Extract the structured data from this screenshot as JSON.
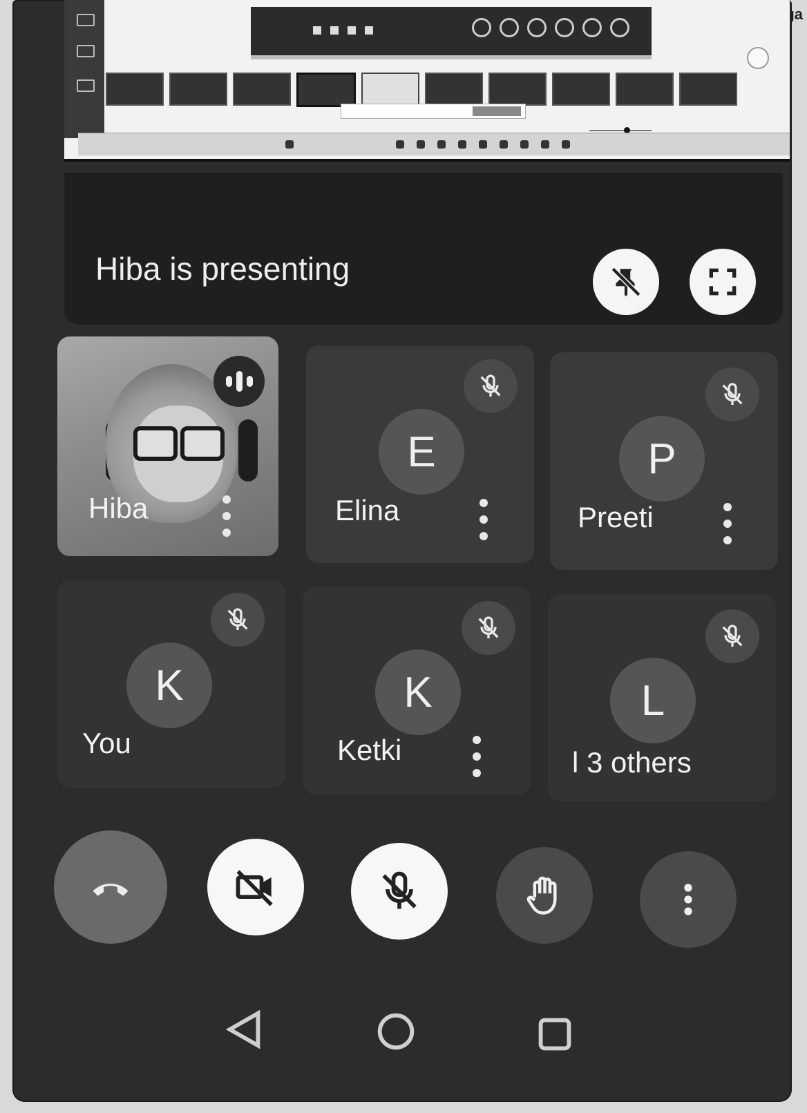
{
  "corner": {
    "text": "Gurga"
  },
  "presenting": {
    "text": "Hiba is presenting",
    "unpin_icon": "unpin-icon",
    "fullscreen_icon": "fullscreen-icon"
  },
  "participants": [
    {
      "name": "Hiba",
      "initial": "",
      "video": true,
      "speaking": true,
      "muted": false,
      "menu": true
    },
    {
      "name": "Elina",
      "initial": "E",
      "video": false,
      "muted": true,
      "menu": true
    },
    {
      "name": "Preeti",
      "initial": "P",
      "video": false,
      "muted": true,
      "menu": true
    },
    {
      "name": "You",
      "initial": "K",
      "video": false,
      "muted": true,
      "menu": false
    },
    {
      "name": "Ketki",
      "initial": "K",
      "video": false,
      "muted": true,
      "menu": true
    },
    {
      "name": "l 3 others",
      "initial": "L",
      "video": false,
      "muted": true,
      "menu": false
    }
  ],
  "controls": {
    "end_call_icon": "end-call-icon",
    "camera_icon": "camera-off-icon",
    "mic_icon": "mic-off-icon",
    "raise_hand_icon": "raise-hand-icon",
    "more_icon": "more-vert-icon"
  },
  "navbar": {
    "back_icon": "back-triangle-icon",
    "home_icon": "home-circle-icon",
    "recents_icon": "recents-square-icon"
  }
}
